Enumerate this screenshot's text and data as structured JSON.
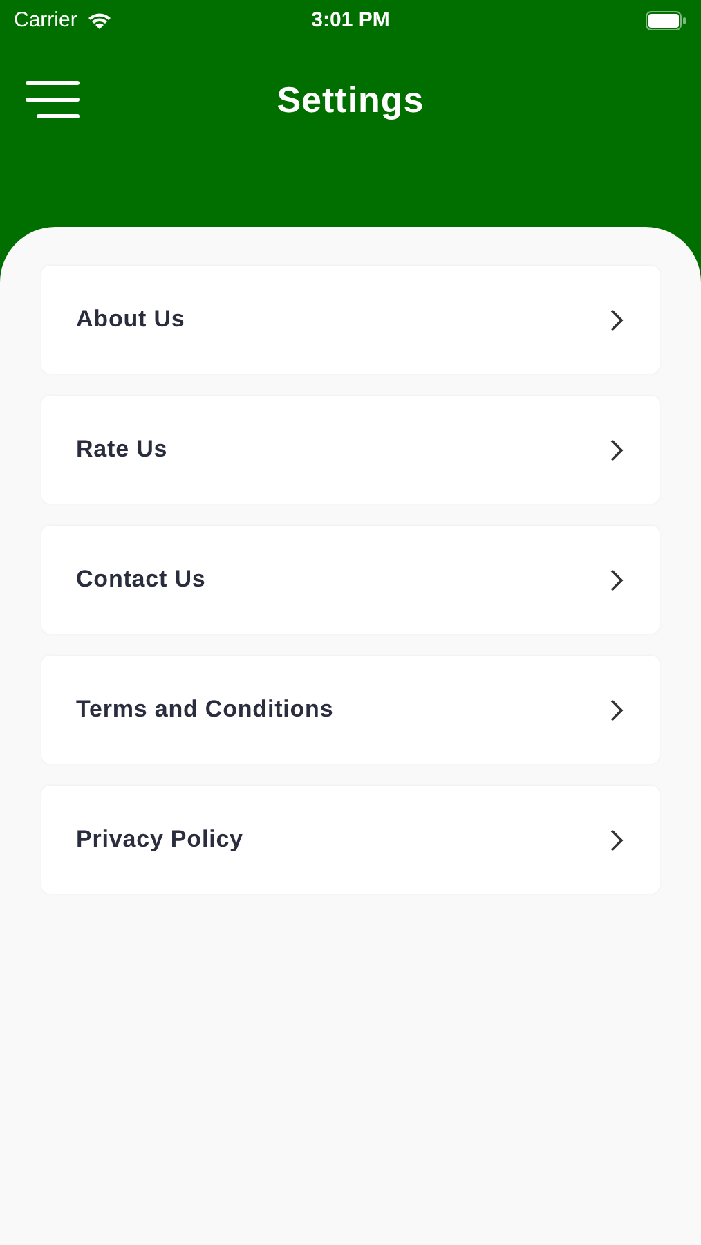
{
  "status_bar": {
    "carrier": "Carrier",
    "time": "3:01 PM"
  },
  "header": {
    "title": "Settings"
  },
  "items": [
    {
      "label": "About Us"
    },
    {
      "label": "Rate Us"
    },
    {
      "label": "Contact Us"
    },
    {
      "label": "Terms and Conditions"
    },
    {
      "label": "Privacy Policy"
    }
  ]
}
